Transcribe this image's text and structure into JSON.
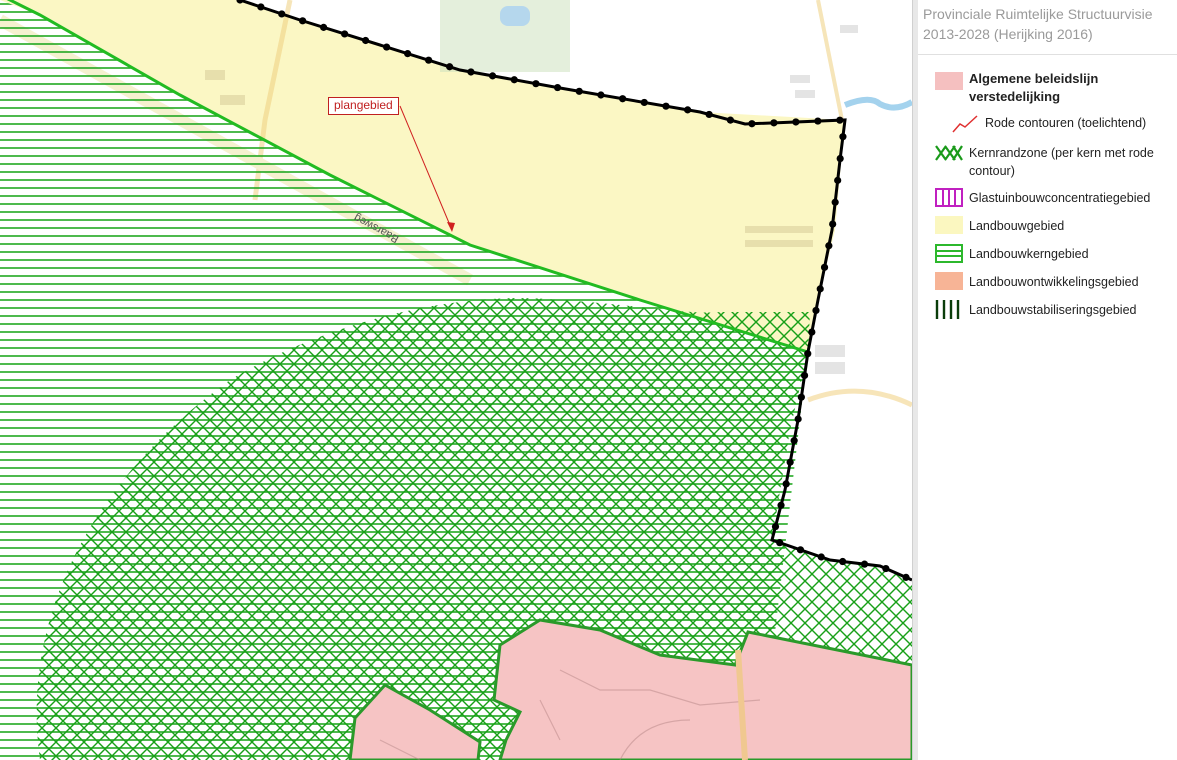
{
  "legend": {
    "title": "Provinciale Ruimtelijke Structuurvisie 2013-2028 (Herijking 2016)",
    "items": [
      {
        "label": "Algemene beleidslijn verstedelijking",
        "swatch": "pink-fill-icon",
        "color": "#f5b8b8"
      },
      {
        "label": "Rode contouren (toelichtend)",
        "swatch": "red-line-icon",
        "color": "#e03030"
      },
      {
        "label": "Kernrandzone (per kern met rode contour)",
        "swatch": "green-crosshatch-icon",
        "color": "#1a9a1a"
      },
      {
        "label": "Glastuinbouwconcentratiegebied",
        "swatch": "magenta-vertical-hatch-icon",
        "color": "#c020c0"
      },
      {
        "label": "Landbouwgebied",
        "swatch": "yellow-fill-icon",
        "color": "#fbf7c0"
      },
      {
        "label": "Landbouwkerngebied",
        "swatch": "green-horizontal-hatch-icon",
        "color": "#2cb82c"
      },
      {
        "label": "Landbouwontwikkelingsgebied",
        "swatch": "salmon-fill-icon",
        "color": "#f7b496"
      },
      {
        "label": "Landbouwstabiliseringsgebied",
        "swatch": "dark-green-vertical-hatch-icon",
        "color": "#0a4a0a"
      }
    ]
  },
  "map": {
    "plan_label": "plangebied",
    "road_name": "Baarsweg"
  }
}
